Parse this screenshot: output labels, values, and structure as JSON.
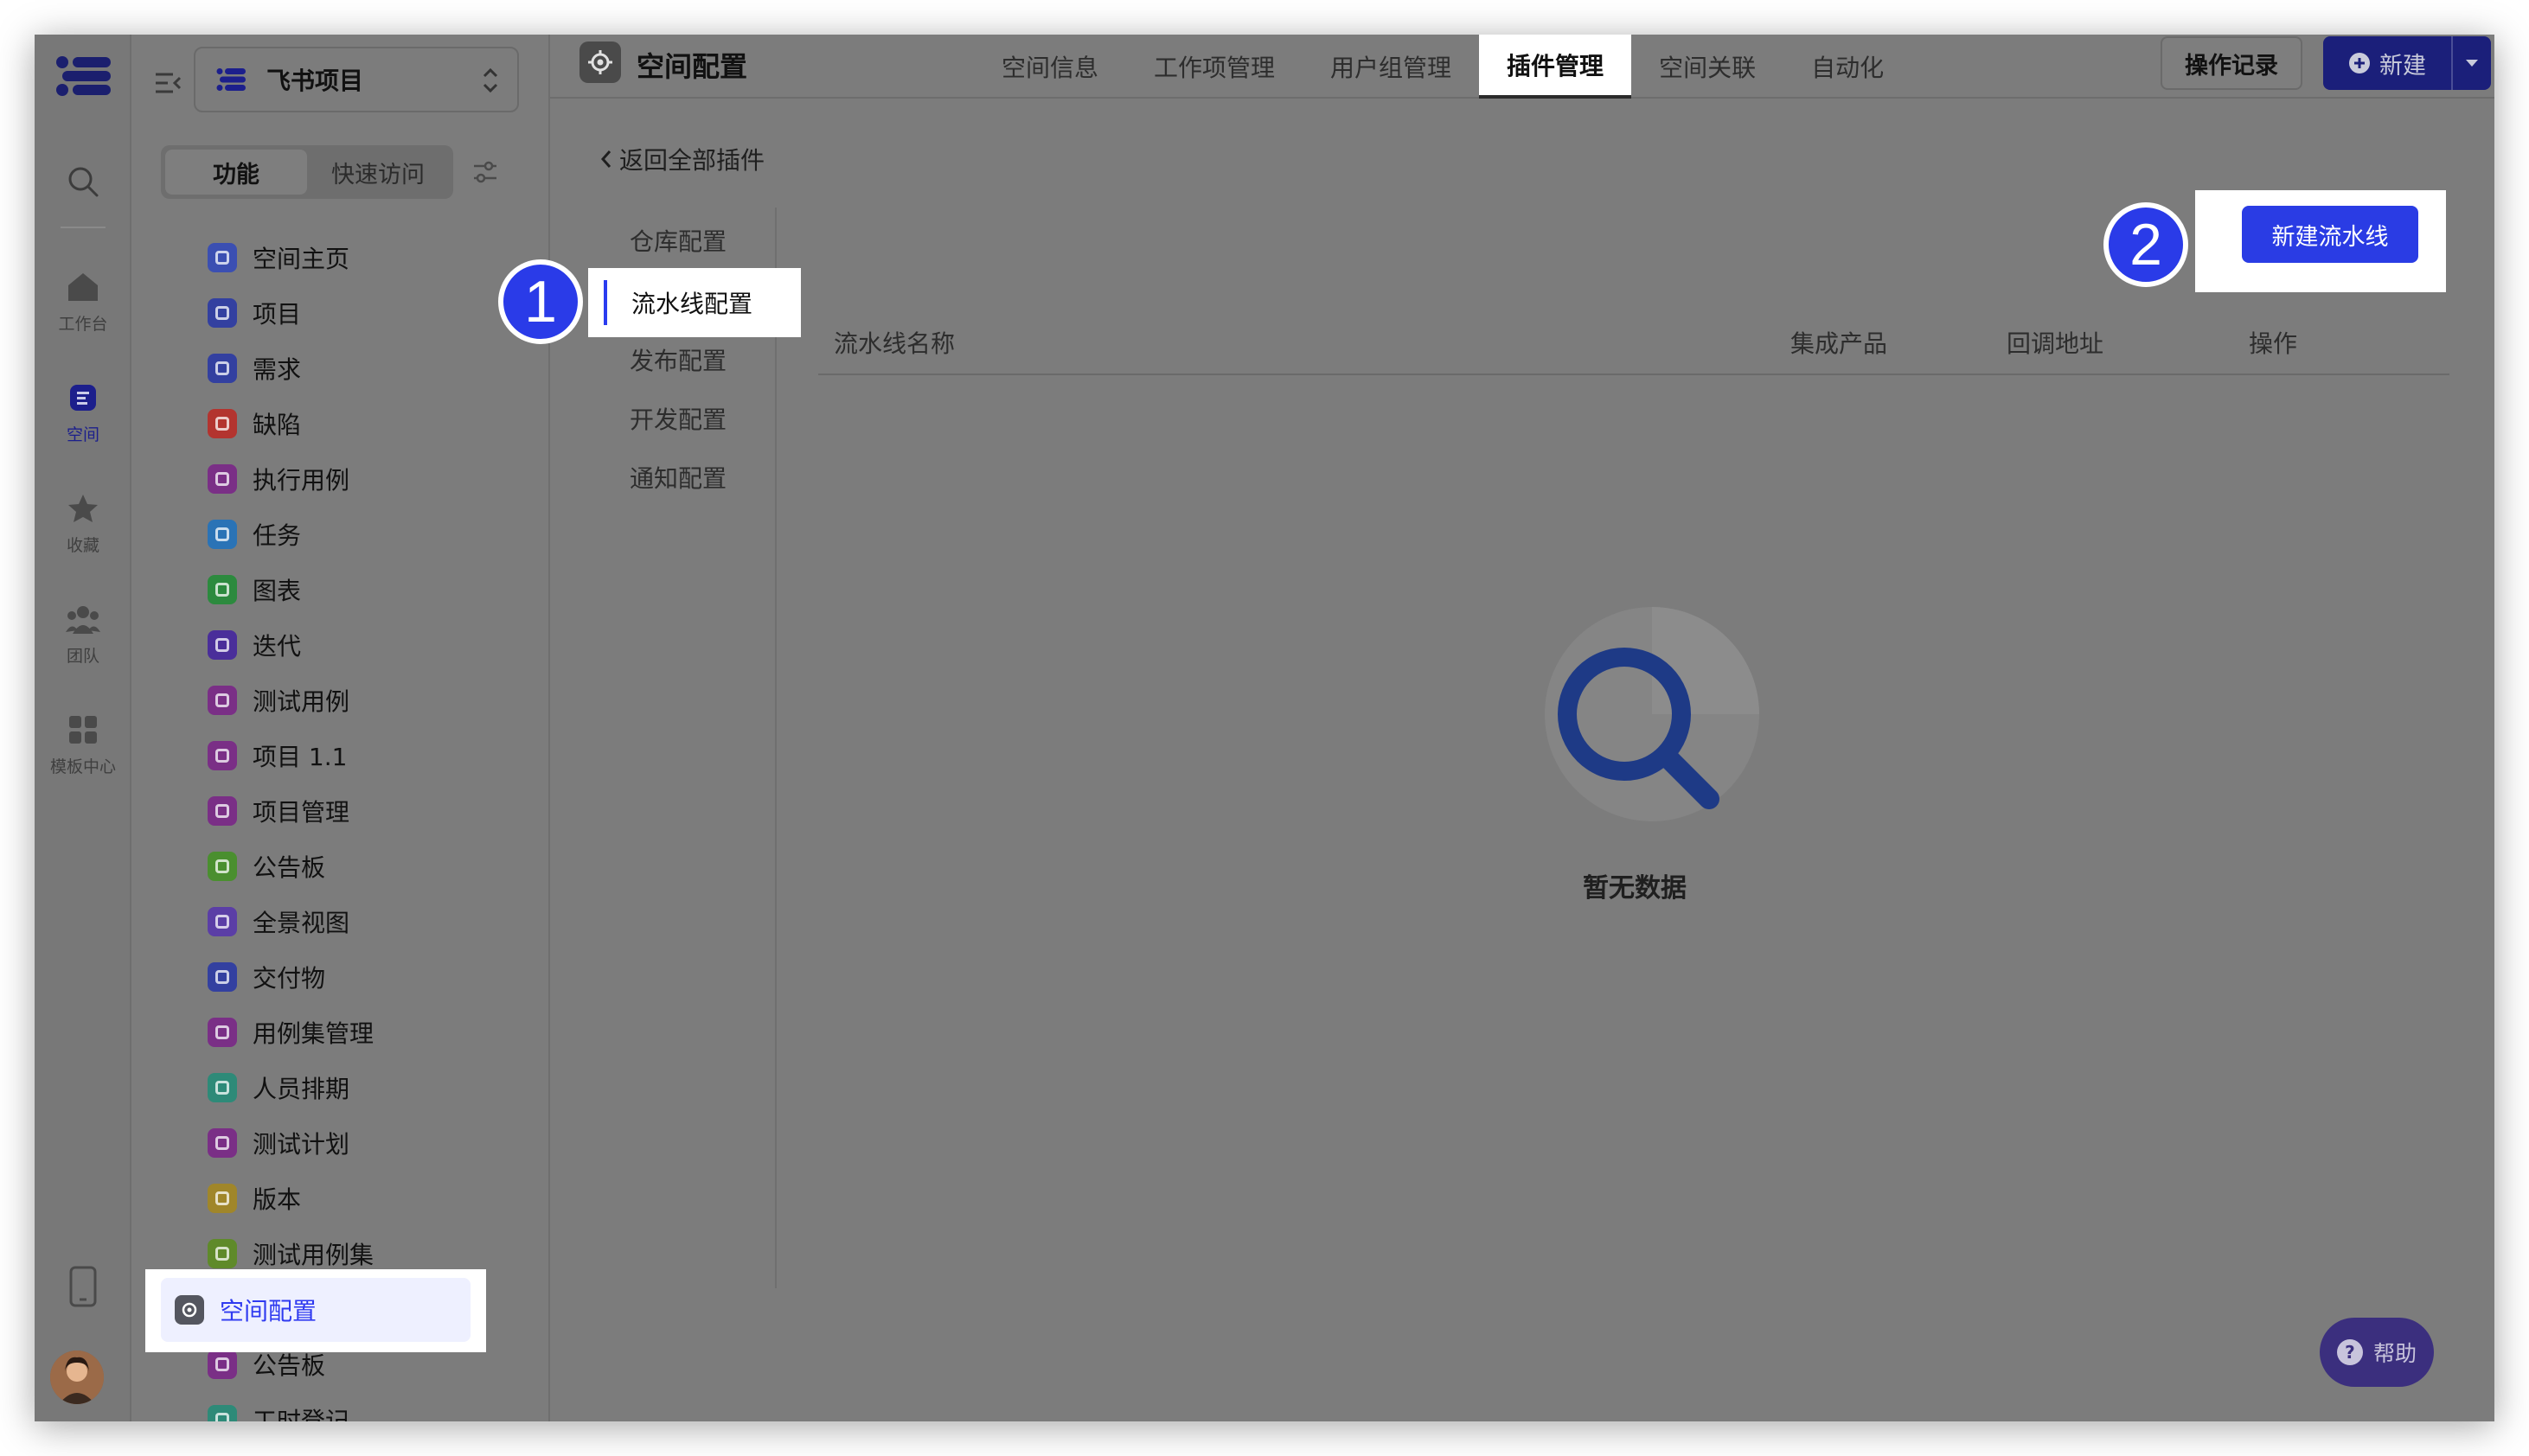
{
  "rail": {
    "items": [
      {
        "label": "工作台",
        "icon": "home-icon"
      },
      {
        "label": "空间",
        "icon": "space-icon"
      },
      {
        "label": "收藏",
        "icon": "star-icon"
      },
      {
        "label": "团队",
        "icon": "team-icon"
      },
      {
        "label": "模板中心",
        "icon": "template-icon"
      }
    ]
  },
  "sidebar": {
    "project_name": "飞书项目",
    "tabs": [
      "功能",
      "快速访问"
    ],
    "items": [
      {
        "label": "空间主页",
        "color": "#3b4fb2"
      },
      {
        "label": "项目",
        "color": "#3340a0"
      },
      {
        "label": "需求",
        "color": "#3340a0"
      },
      {
        "label": "缺陷",
        "color": "#b3342f"
      },
      {
        "label": "执行用例",
        "color": "#7a2f86"
      },
      {
        "label": "任务",
        "color": "#2a73b6"
      },
      {
        "label": "图表",
        "color": "#2c8a3e"
      },
      {
        "label": "迭代",
        "color": "#4a2e9a"
      },
      {
        "label": "测试用例",
        "color": "#7a2f86"
      },
      {
        "label": "项目 1.1",
        "color": "#7a2f86"
      },
      {
        "label": "项目管理",
        "color": "#7a2f86"
      },
      {
        "label": "公告板",
        "color": "#4a8f2f"
      },
      {
        "label": "全景视图",
        "color": "#5b3ea6"
      },
      {
        "label": "交付物",
        "color": "#3340a0"
      },
      {
        "label": "用例集管理",
        "color": "#7a2f86"
      },
      {
        "label": "人员排期",
        "color": "#2e8a78"
      },
      {
        "label": "测试计划",
        "color": "#7a2f86"
      },
      {
        "label": "版本",
        "color": "#a0862a"
      },
      {
        "label": "测试用例集",
        "color": "#5f8a2a"
      }
    ],
    "highlight_item": "空间配置",
    "after_items": [
      {
        "label": "公告板",
        "color": "#7a2f86"
      },
      {
        "label": "工时登记",
        "color": "#2e8a78"
      }
    ]
  },
  "topbar": {
    "title": "空间配置",
    "tabs": [
      "空间信息",
      "工作项管理",
      "用户组管理",
      "插件管理",
      "空间关联",
      "自动化"
    ],
    "active_tab": "插件管理",
    "log_button": "操作记录",
    "new_button": "新建"
  },
  "content": {
    "back_link": "返回全部插件",
    "subnav": [
      "仓库配置",
      "流水线配置",
      "发布配置",
      "开发配置",
      "通知配置"
    ],
    "active_subnav": "流水线配置",
    "columns": [
      "流水线名称",
      "集成产品",
      "回调地址",
      "操作"
    ],
    "create_button": "新建流水线",
    "empty_text": "暂无数据",
    "badges": [
      "1",
      "2"
    ]
  },
  "help": "帮助",
  "colors": {
    "accent": "#2a3ce4",
    "overlay": "#7c7c7c"
  }
}
